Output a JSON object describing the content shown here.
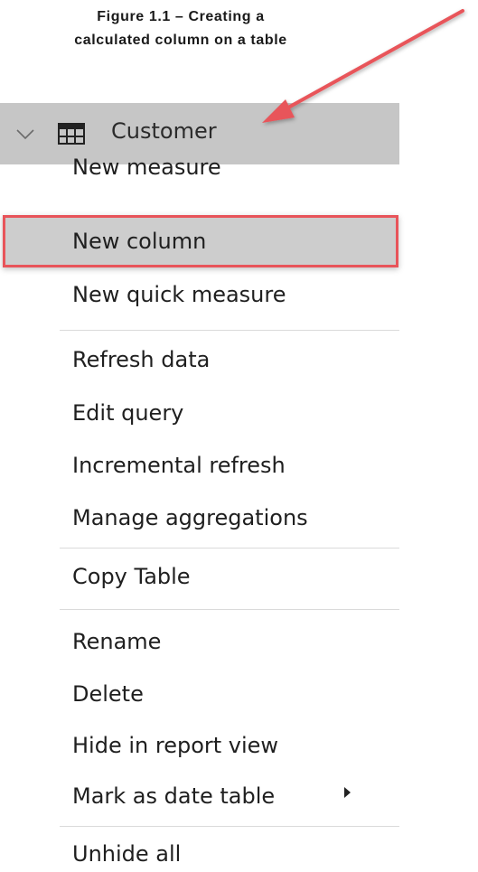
{
  "caption": {
    "line1": "Figure 1.1 – Creating a",
    "line2": "calculated column on a table"
  },
  "table": {
    "name": "Customer"
  },
  "menu": {
    "items": [
      {
        "label": "New measure"
      },
      {
        "label": "New column"
      },
      {
        "label": "New quick measure"
      },
      {
        "label": "Refresh data"
      },
      {
        "label": "Edit query"
      },
      {
        "label": "Incremental refresh"
      },
      {
        "label": "Manage aggregations"
      },
      {
        "label": "Copy Table"
      },
      {
        "label": "Rename"
      },
      {
        "label": "Delete"
      },
      {
        "label": "Hide in report view"
      },
      {
        "label": "Mark as date table"
      },
      {
        "label": "Unhide all"
      }
    ],
    "selected_index": 1
  },
  "colors": {
    "highlight_border": "#e8545a",
    "arrow": "#e8545a",
    "header_bg": "#c6c6c6"
  },
  "icons": {
    "expand": "chevron-down-icon",
    "table": "table-grid-icon",
    "submenu": "submenu-triangle-icon",
    "pointer": "annotation-arrow-icon"
  }
}
